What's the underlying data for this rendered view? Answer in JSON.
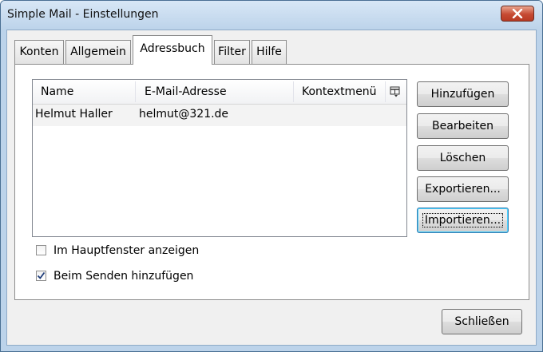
{
  "window": {
    "title": "Simple Mail - Einstellungen"
  },
  "tabs": [
    {
      "label": "Konten"
    },
    {
      "label": "Allgemein"
    },
    {
      "label": "Adressbuch"
    },
    {
      "label": "Filter"
    },
    {
      "label": "Hilfe"
    }
  ],
  "address_list": {
    "columns": [
      "Name",
      "E-Mail-Adresse",
      "Kontextmenü"
    ],
    "column_chooser_icon": "column-chooser-icon",
    "rows": [
      {
        "name": "Helmut Haller",
        "email": "helmut@321.de",
        "context": ""
      }
    ]
  },
  "buttons": {
    "add": "Hinzufügen",
    "edit": "Bearbeiten",
    "delete": "Löschen",
    "export": "Exportieren...",
    "import": "Importieren...",
    "close": "Schließen"
  },
  "options": {
    "show_in_main": {
      "label": "Im Hauptfenster anzeigen",
      "checked": false
    },
    "add_on_send": {
      "label": "Beim Senden hinzufügen",
      "checked": true
    }
  }
}
